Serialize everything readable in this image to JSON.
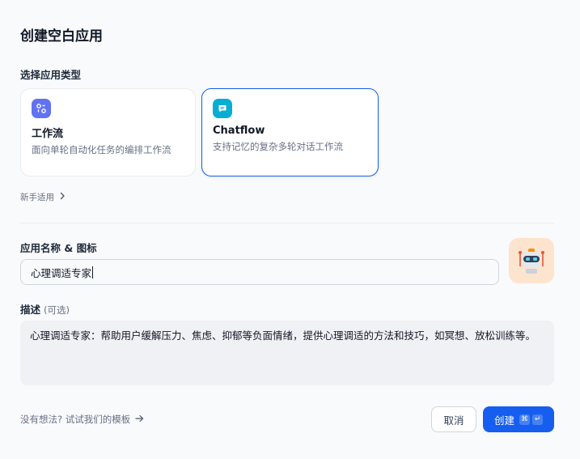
{
  "dialog": {
    "title": "创建空白应用"
  },
  "app_type": {
    "label": "选择应用类型",
    "cards": [
      {
        "title": "工作流",
        "description": "面向单轮自动化任务的编排工作流",
        "icon": "workflow-icon",
        "selected": false
      },
      {
        "title": "Chatflow",
        "description": "支持记忆的复杂多轮对话工作流",
        "icon": "chat-bubble-icon",
        "selected": true
      }
    ],
    "beginner_link": "新手适用"
  },
  "name_icon": {
    "label": "应用名称 & 图标",
    "value": "心理调适专家",
    "icon": "robot-icon"
  },
  "description": {
    "label": "描述",
    "optional": "(可选)",
    "value": "心理调适专家：帮助用户缓解压力、焦虑、抑郁等负面情绪，提供心理调适的方法和技巧，如冥想、放松训练等。"
  },
  "footer": {
    "template_link": "没有想法? 试试我们的模板",
    "cancel_label": "取消",
    "create_label": "创建",
    "shortcut_keys": [
      "⌘",
      "↵"
    ]
  },
  "colors": {
    "primary": "#155eef",
    "workflow_icon_bg": "#6172f3",
    "chatflow_icon_bg": "#06aed4",
    "app_icon_bg": "#fde4cf"
  }
}
